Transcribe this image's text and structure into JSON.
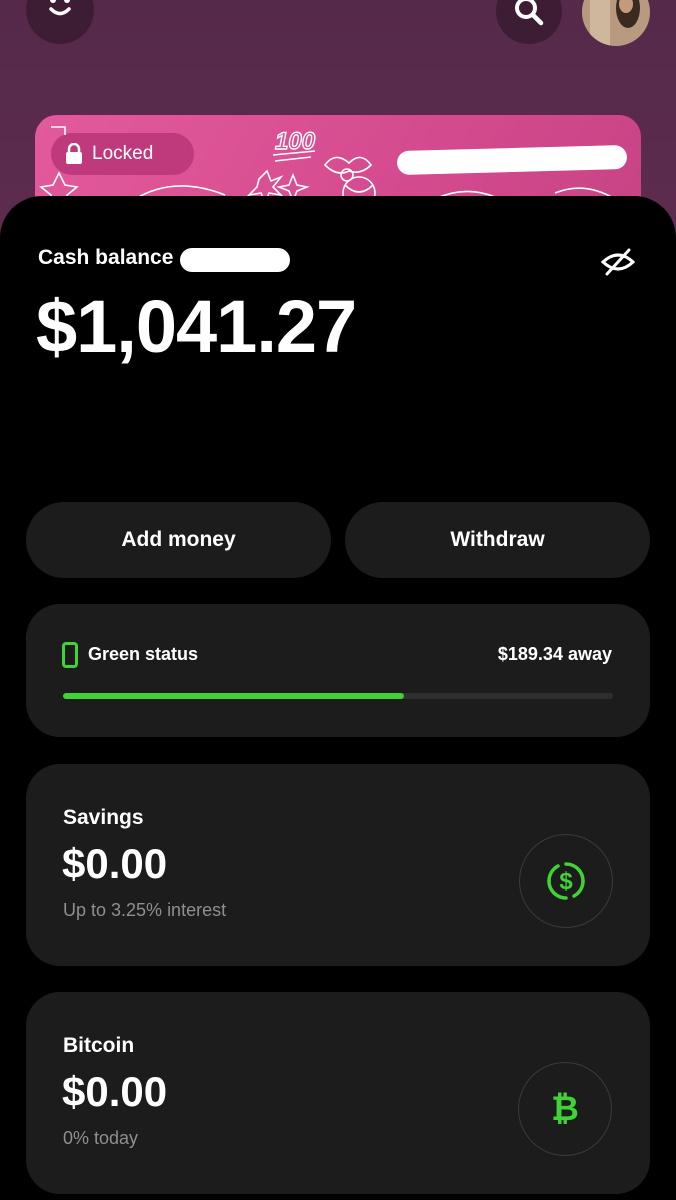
{
  "header": {
    "smile_icon": "smile-icon",
    "search_icon": "search-icon",
    "avatar": "avatar"
  },
  "card": {
    "locked_label": "Locked",
    "sticker_text": "100",
    "lock_icon": "lock-icon"
  },
  "balance": {
    "label": "Cash balance",
    "amount": "$1,041.27",
    "hide_icon": "eye-off-icon"
  },
  "actions": {
    "add_money": "Add money",
    "withdraw": "Withdraw"
  },
  "status": {
    "label": "Green status",
    "away": "$189.34 away",
    "progress": 0.62,
    "accent": "#3fd336"
  },
  "savings": {
    "title": "Savings",
    "amount": "$0.00",
    "subtitle": "Up to 3.25% interest",
    "icon": "dollar-cycle-icon"
  },
  "bitcoin": {
    "title": "Bitcoin",
    "amount": "$0.00",
    "subtitle": "0% today",
    "icon": "bitcoin-icon"
  }
}
